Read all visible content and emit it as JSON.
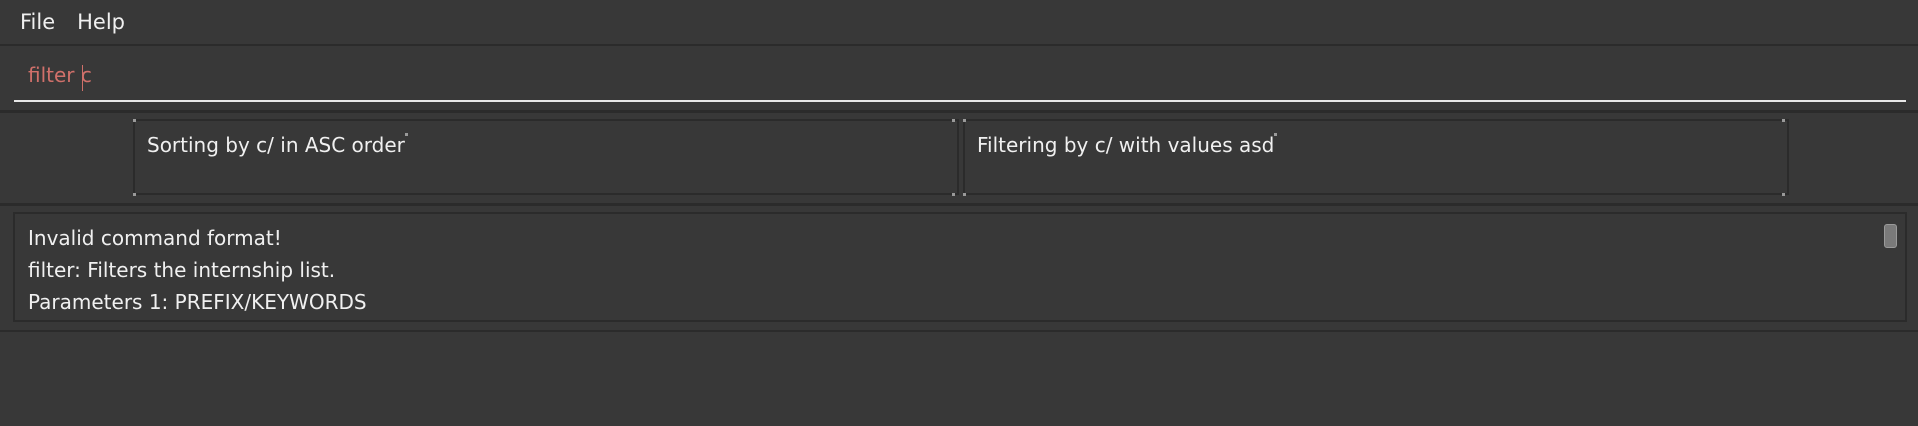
{
  "menu": {
    "file": "File",
    "help": "Help"
  },
  "command": {
    "value": "filter c"
  },
  "status": {
    "sort": "Sorting by c/ in ASC order",
    "filter": "Filtering by c/ with values asd"
  },
  "result": {
    "lines": [
      "Invalid command format!",
      "filter: Filters the internship list.",
      "Parameters 1: PREFIX/KEYWORDS"
    ]
  },
  "colors": {
    "background": "#383838",
    "border": "#2b2b2b",
    "command_text": "#d0706a"
  }
}
